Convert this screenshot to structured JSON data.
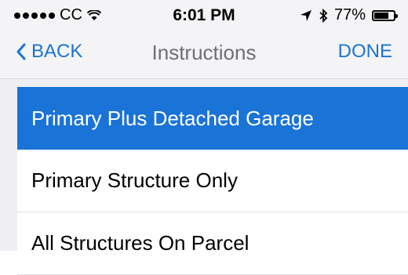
{
  "status_bar": {
    "carrier": "CC",
    "time": "6:01 PM",
    "battery_percent": "77%",
    "battery_level": 0.77
  },
  "nav": {
    "back_label": "BACK",
    "title": "Instructions",
    "done_label": "DONE"
  },
  "options": [
    {
      "label": "Primary Plus Detached Garage",
      "selected": true
    },
    {
      "label": "Primary Structure Only",
      "selected": false
    },
    {
      "label": "All Structures On Parcel",
      "selected": false
    }
  ],
  "colors": {
    "accent": "#1a73d6",
    "selected_bg": "#1a73d6",
    "bar_bg": "#f4f4f6"
  }
}
